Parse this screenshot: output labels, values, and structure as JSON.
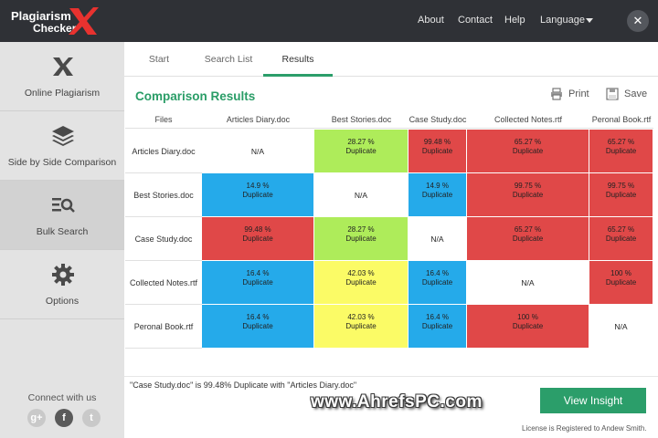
{
  "app": {
    "logo_line1": "Plagiarism",
    "logo_line2": "Checker"
  },
  "topnav": {
    "about": "About",
    "contact": "Contact",
    "help": "Help",
    "language": "Language",
    "close": "✕"
  },
  "sidebar": {
    "items": [
      {
        "label": "Online Plagiarism",
        "icon": "x-logo-icon"
      },
      {
        "label": "Side by Side Comparison",
        "icon": "layers-icon"
      },
      {
        "label": "Bulk Search",
        "icon": "list-search-icon",
        "active": true
      },
      {
        "label": "Options",
        "icon": "gear-icon"
      }
    ],
    "connect_label": "Connect with us",
    "social": {
      "google": "g+",
      "facebook": "f",
      "twitter": "t"
    }
  },
  "tabs": {
    "start": "Start",
    "search_list": "Search List",
    "results": "Results"
  },
  "main": {
    "title": "Comparison Results",
    "print": "Print",
    "save": "Save"
  },
  "colors": {
    "red": "#e04848",
    "green": "#aeec5a",
    "blue": "#25aaea",
    "yellow": "#fbfb66",
    "na": "#ffffff",
    "accent": "#2b9e6a"
  },
  "grid": {
    "corner": "Files",
    "columns": [
      "Articles Diary.doc",
      "Best Stories.doc",
      "Case Study.doc",
      "Collected Notes.rtf",
      "Peronal Book.rtf"
    ],
    "rows": [
      {
        "label": "Articles Diary.doc",
        "cells": [
          {
            "pct": "N/A",
            "dup": "",
            "color": "na"
          },
          {
            "pct": "28.27 %",
            "dup": "Duplicate",
            "color": "green"
          },
          {
            "pct": "99.48 %",
            "dup": "Duplicate",
            "color": "red"
          },
          {
            "pct": "65.27 %",
            "dup": "Duplicate",
            "color": "red"
          },
          {
            "pct": "65.27 %",
            "dup": "Duplicate",
            "color": "red"
          }
        ]
      },
      {
        "label": "Best Stories.doc",
        "cells": [
          {
            "pct": "14.9 %",
            "dup": "Duplicate",
            "color": "blue"
          },
          {
            "pct": "N/A",
            "dup": "",
            "color": "na"
          },
          {
            "pct": "14.9 %",
            "dup": "Duplicate",
            "color": "blue"
          },
          {
            "pct": "99.75 %",
            "dup": "Duplicate",
            "color": "red"
          },
          {
            "pct": "99.75 %",
            "dup": "Duplicate",
            "color": "red"
          }
        ]
      },
      {
        "label": "Case Study.doc",
        "cells": [
          {
            "pct": "99.48 %",
            "dup": "Duplicate",
            "color": "red"
          },
          {
            "pct": "28.27 %",
            "dup": "Duplicate",
            "color": "green"
          },
          {
            "pct": "N/A",
            "dup": "",
            "color": "na"
          },
          {
            "pct": "65.27 %",
            "dup": "Duplicate",
            "color": "red"
          },
          {
            "pct": "65.27 %",
            "dup": "Duplicate",
            "color": "red"
          }
        ]
      },
      {
        "label": "Collected Notes.rtf",
        "cells": [
          {
            "pct": "16.4 %",
            "dup": "Duplicate",
            "color": "blue"
          },
          {
            "pct": "42.03 %",
            "dup": "Duplicate",
            "color": "yellow"
          },
          {
            "pct": "16.4 %",
            "dup": "Duplicate",
            "color": "blue"
          },
          {
            "pct": "N/A",
            "dup": "",
            "color": "na"
          },
          {
            "pct": "100 %",
            "dup": "Duplicate",
            "color": "red"
          }
        ]
      },
      {
        "label": "Peronal Book.rtf",
        "cells": [
          {
            "pct": "16.4 %",
            "dup": "Duplicate",
            "color": "blue"
          },
          {
            "pct": "42.03 %",
            "dup": "Duplicate",
            "color": "yellow"
          },
          {
            "pct": "16.4 %",
            "dup": "Duplicate",
            "color": "blue"
          },
          {
            "pct": "100 %",
            "dup": "Duplicate",
            "color": "red"
          },
          {
            "pct": "N/A",
            "dup": "",
            "color": "na"
          }
        ]
      }
    ]
  },
  "footer": {
    "status": "\"Case Study.doc\" is 99.48% Duplicate with \"Articles Diary.doc\"",
    "view_insight": "View Insight",
    "license": "License is Registered to Andew Smith.",
    "watermark": "www.AhrefsPC.com"
  }
}
